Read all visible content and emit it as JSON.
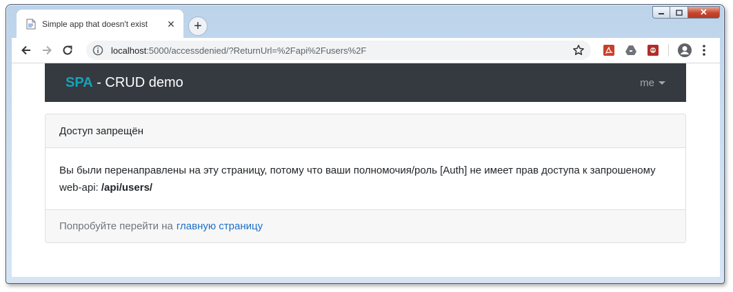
{
  "browser": {
    "tab_title": "Simple app that doesn't exist",
    "tab_close": "✕",
    "new_tab": "+",
    "url_host": "localhost",
    "url_path": ":5000/accessdenied/?ReturnUrl=%2Fapi%2Fusers%2F",
    "window_controls": {
      "minimize": "▭",
      "maximize": "□",
      "close": "✕"
    }
  },
  "app": {
    "brand_bold": "SPA",
    "brand_rest": " - CRUD demo",
    "user_menu": "me"
  },
  "card": {
    "header": "Доступ запрещён",
    "body_text": "Вы были перенаправлены на эту страницу, потому что ваши полномочия/роль [Auth] не имеет прав доступа к запрошеному web-api: ",
    "body_api": "/api/users/",
    "footer_text": "Попробуйте перейти на",
    "footer_link": "главную страницу"
  },
  "colors": {
    "navbar_bg": "#343a40",
    "brand_accent": "#17a2b8",
    "link": "#1e6fc4"
  }
}
